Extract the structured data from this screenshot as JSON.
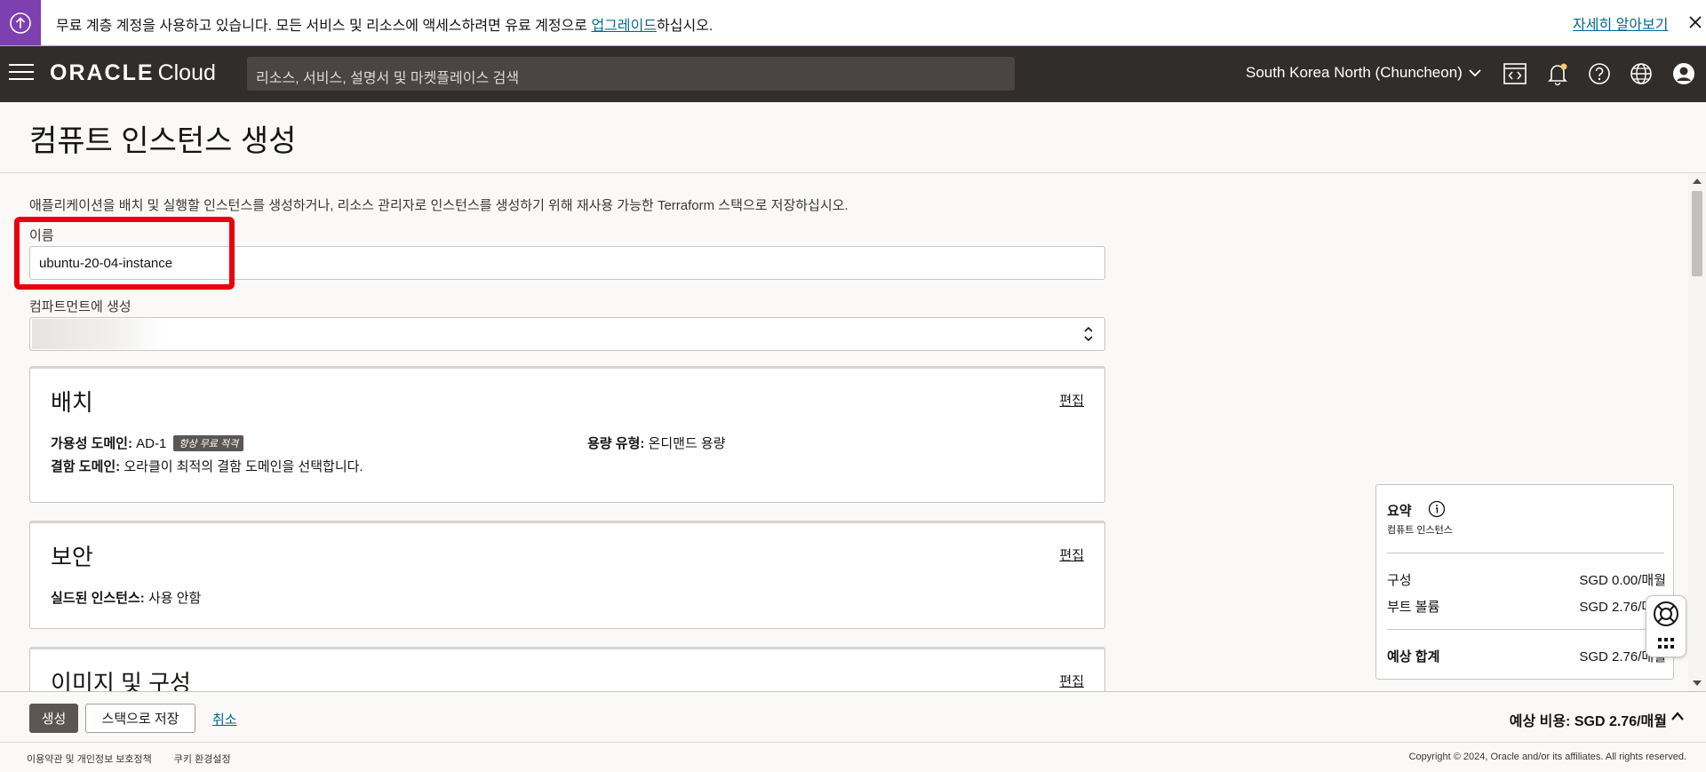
{
  "banner": {
    "text_before": "무료 계층 계정을 사용하고 있습니다. 모든 서비스 및 리소스에 액세스하려면 유료 계정으로 ",
    "upgrade_link": "업그레이드",
    "text_after": "하십시오.",
    "learn_more": "자세히 알아보기",
    "icon": "arrow-up-circle-icon"
  },
  "header": {
    "logo_oracle": "ORACLE",
    "logo_cloud": "Cloud",
    "search_placeholder": "리소스, 서비스, 설명서 및 마켓플레이스 검색",
    "region": "South Korea North (Chuncheon)",
    "icons": [
      "code-editor-icon",
      "bell-icon",
      "help-icon",
      "globe-icon",
      "user-avatar-icon"
    ]
  },
  "page": {
    "title": "컴퓨트 인스턴스 생성",
    "intro": "애플리케이션을 배치 및 실행할 인스턴스를 생성하거나, 리소스 관리자로 인스턴스를 생성하기 위해 재사용 가능한 Terraform 스택으로 저장하십시오."
  },
  "form": {
    "name_label": "이름",
    "name_value": "ubuntu-20-04-instance",
    "compartment_label": "컴파트먼트에 생성"
  },
  "placement": {
    "title": "배치",
    "edit": "편집",
    "ad_key": "가용성 도메인:",
    "ad_value": "AD-1",
    "ad_badge": "항상 무료 적격",
    "capacity_key": "용량 유형:",
    "capacity_value": "온디맨드 용량",
    "fault_key": "결함 도메인:",
    "fault_value": "오라클이 최적의 결함 도메인을 선택합니다."
  },
  "security": {
    "title": "보안",
    "edit": "편집",
    "shielded_key": "실드된 인스턴스:",
    "shielded_value": "사용 안함"
  },
  "image": {
    "title": "이미지 및 구성",
    "edit": "편집"
  },
  "summary": {
    "title": "요약",
    "subtitle": "컴퓨트 인스턴스",
    "rows": [
      {
        "label": "구성",
        "value": "SGD 0.00/매월"
      },
      {
        "label": "부트 볼륨",
        "value": "SGD 2.76/매월"
      }
    ],
    "total_label": "예상 합계",
    "total_value": "SGD 2.76/매월"
  },
  "actions": {
    "create": "생성",
    "save_stack": "스택으로 저장",
    "cancel": "취소",
    "est_label": "예상 비용:",
    "est_value": "SGD 2.76/매월"
  },
  "footer": {
    "terms": "이용약관 및 개인정보 보호정책",
    "cookies": "쿠키 환경설정",
    "copyright": "Copyright © 2024, Oracle and/or its affiliates. All rights reserved."
  },
  "colors": {
    "banner_accent": "#7e3fb0",
    "header_bg": "#312d2a",
    "link": "#00688c",
    "highlight": "#e8000d",
    "primary_button": "#5b5652"
  }
}
